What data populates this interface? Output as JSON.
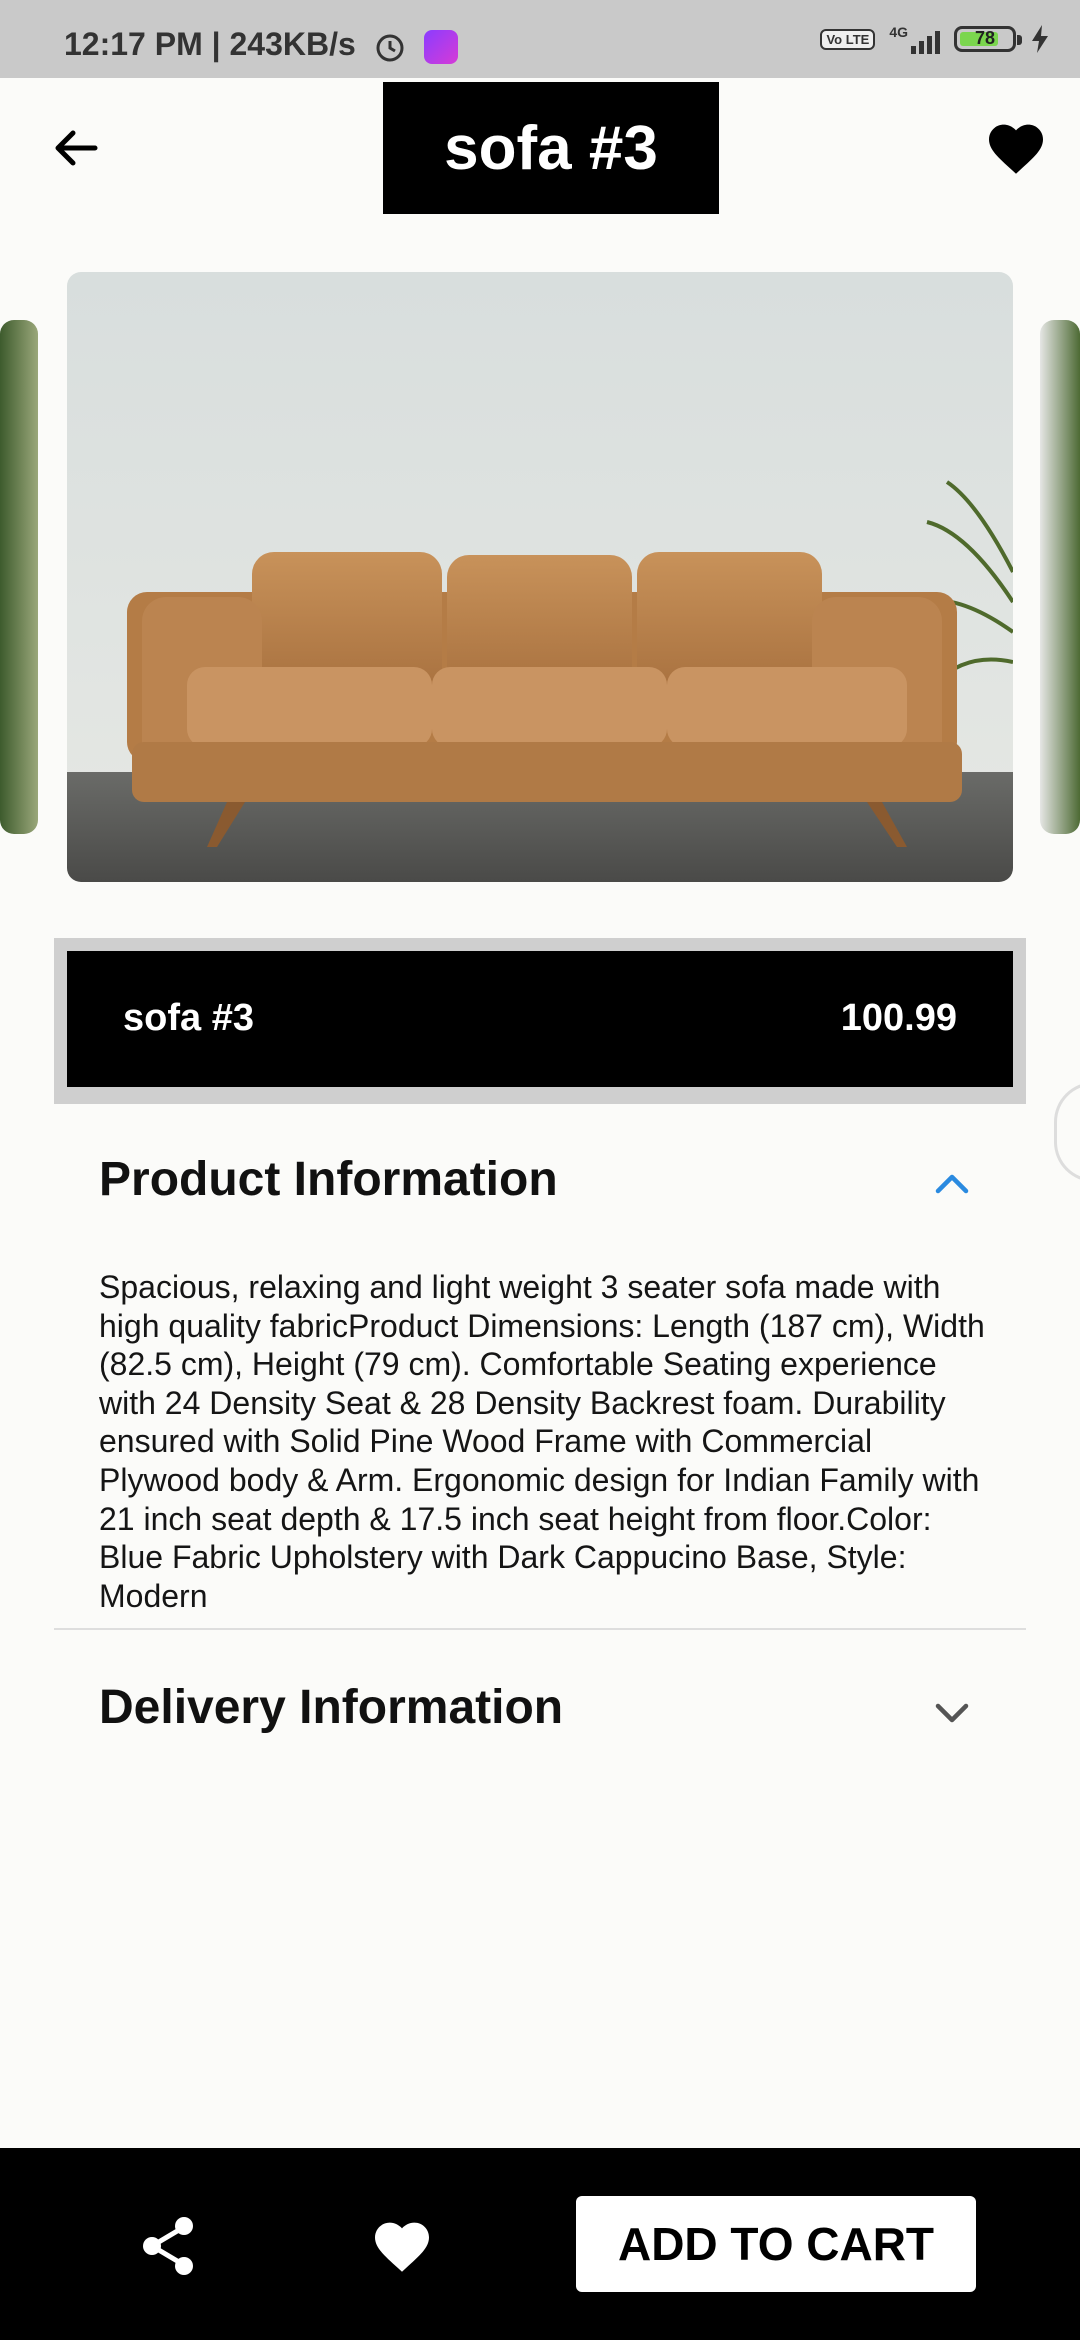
{
  "status_bar": {
    "time_speed": "12:17 PM | 243KB/s",
    "volte": "Vo LTE",
    "network": "4G",
    "battery": "78",
    "battery_level": 0.78
  },
  "header": {
    "title": "sofa #3",
    "icons": {
      "back": "arrow-left-icon",
      "favorite": "heart-icon"
    }
  },
  "product": {
    "name": "sofa #3",
    "price": "100.99"
  },
  "accordion": {
    "product_info": {
      "title": "Product Information",
      "expanded": true,
      "text": "Spacious, relaxing and light weight 3 seater sofa made with high quality fabricProduct Dimensions: Length (187 cm), Width (82.5 cm), Height (79 cm). Comfortable Seating experience with 24 Density Seat & 28 Density Backrest foam. Durability ensured with Solid Pine Wood Frame with Commercial Plywood body & Arm. Ergonomic design for Indian Family with 21 inch seat depth & 17.5 inch seat height from floor.Color: Blue Fabric Upholstery with Dark Cappucino Base, Style: Modern"
    },
    "delivery_info": {
      "title": "Delivery Information",
      "expanded": false
    }
  },
  "bottom_bar": {
    "add_to_cart": "ADD TO CART",
    "icons": {
      "share": "share-icon",
      "favorite": "heart-icon"
    }
  },
  "colors": {
    "accent_chevron": "#2a8ae0",
    "bar_background": "#000000",
    "page_background": "#fbfbf9"
  }
}
